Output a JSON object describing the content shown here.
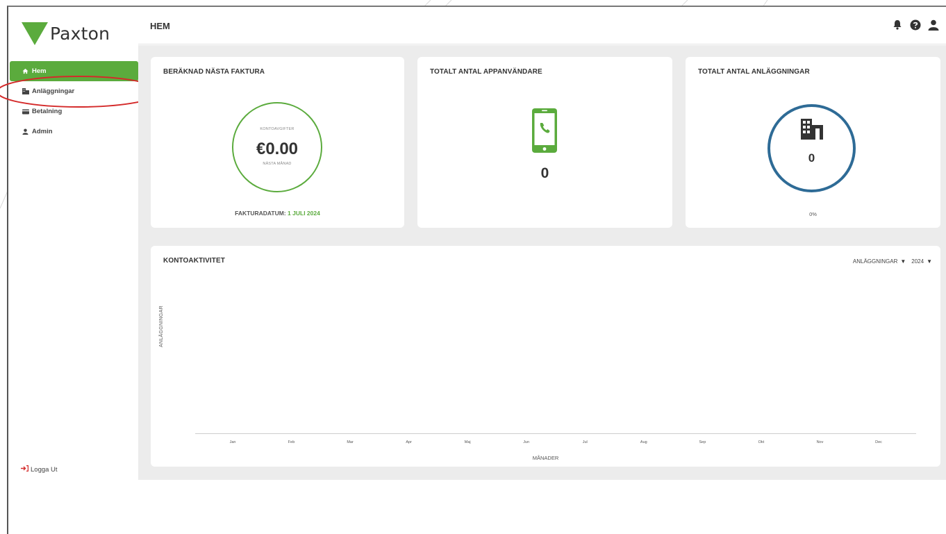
{
  "brand": {
    "name": "Paxton",
    "color": "#5bab3d"
  },
  "sidebar": {
    "items": [
      {
        "label": "Hem",
        "icon": "home-icon",
        "active": true
      },
      {
        "label": "Anläggningar",
        "icon": "building-icon",
        "active": false
      },
      {
        "label": "Betalning",
        "icon": "card-icon",
        "active": false
      },
      {
        "label": "Admin",
        "icon": "user-icon",
        "active": false
      }
    ],
    "logout_label": "Logga Ut"
  },
  "header": {
    "title": "HEM",
    "icons": [
      "bell-icon",
      "help-icon",
      "user-icon"
    ]
  },
  "cards": {
    "invoice": {
      "title": "BERÄKNAD NÄSTA FAKTURA",
      "caption_top": "KONTOAVGIFTER",
      "amount": "€0.00",
      "caption_bottom": "NÄSTA MÅNAD",
      "date_label": "FAKTURADATUM:",
      "date_value": "1 JULI 2024"
    },
    "app_users": {
      "title": "TOTALT ANTAL APPANVÄNDARE",
      "value": "0"
    },
    "sites": {
      "title": "TOTALT ANTAL ANLÄGGNINGAR",
      "value": "0",
      "percent": "0%"
    }
  },
  "activity": {
    "title": "KONTOAKTIVITET",
    "filter_type": "ANLÄGGNINGAR",
    "filter_year": "2024"
  },
  "chart_data": {
    "type": "bar",
    "categories": [
      "Jan",
      "Feb",
      "Mar",
      "Apr",
      "Maj",
      "Jun",
      "Jul",
      "Aug",
      "Sep",
      "Okt",
      "Nov",
      "Dec"
    ],
    "values": [],
    "xlabel": "MÅNADER",
    "ylabel": "ANLÄGGNINGAR",
    "grid": false
  }
}
